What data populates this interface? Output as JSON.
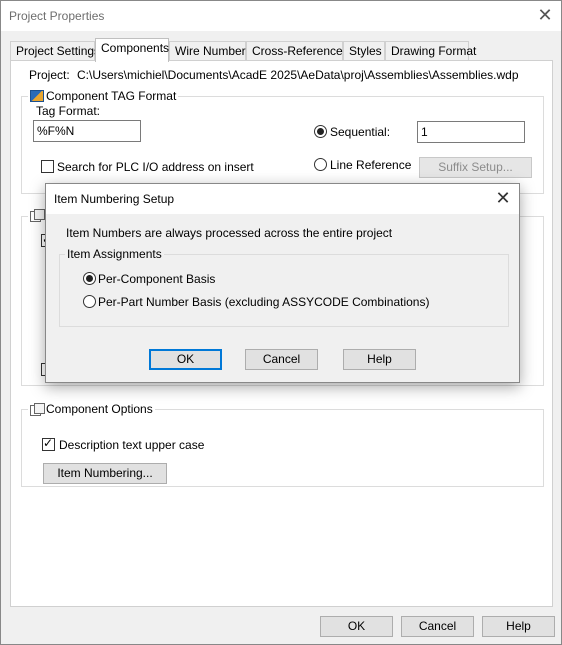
{
  "window": {
    "title": "Project Properties"
  },
  "tabs": [
    {
      "label": "Project Settings"
    },
    {
      "label": "Components"
    },
    {
      "label": "Wire Numbers"
    },
    {
      "label": "Cross-References"
    },
    {
      "label": "Styles"
    },
    {
      "label": "Drawing Format"
    }
  ],
  "project": {
    "label": "Project:",
    "path": "C:\\Users\\michiel\\Documents\\AcadE 2025\\AeData\\proj\\Assemblies\\Assemblies.wdp"
  },
  "tag_format": {
    "group_title": "Component TAG Format",
    "tag_format_label": "Tag Format:",
    "tag_format_value": "%F%N",
    "sequential_label": "Sequential:",
    "sequential_value": "1",
    "line_reference_label": "Line Reference",
    "suffix_setup_label": "Suffix Setup...",
    "plc_search_label": "Search for PLC I/O address on insert"
  },
  "component_options": {
    "group_title": "Component Options",
    "upper_case_label": "Description text upper case",
    "item_numbering_label": "Item Numbering..."
  },
  "footer": {
    "ok_label": "OK",
    "cancel_label": "Cancel",
    "help_label": "Help"
  },
  "dialog": {
    "title": "Item Numbering Setup",
    "message": "Item Numbers are always processed across the entire project",
    "assignments_title": "Item Assignments",
    "per_component_label": "Per-Component Basis",
    "per_part_label": "Per-Part Number Basis (excluding ASSYCODE Combinations)",
    "ok_label": "OK",
    "cancel_label": "Cancel",
    "help_label": "Help"
  }
}
